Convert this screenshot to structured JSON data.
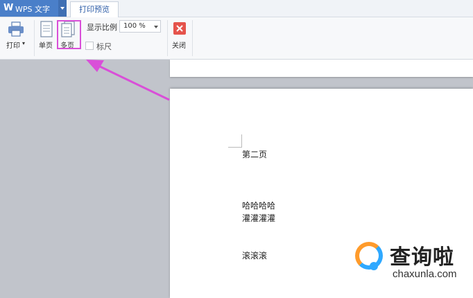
{
  "app": {
    "logo": "W",
    "title": "WPS 文字"
  },
  "tabs": [
    {
      "label": "打印预览",
      "active": true
    }
  ],
  "ribbon": {
    "print_label": "打印",
    "single_page_label": "单页",
    "multi_page_label": "多页",
    "zoom_label": "显示比例",
    "zoom_value": "100 %",
    "ruler_label": "标尺",
    "ruler_checked": false,
    "close_label": "关闭"
  },
  "document": {
    "page_heading": "第二页",
    "lines": [
      "哈哈哈哈",
      "灌灌灌灌",
      "滚滚滚"
    ]
  },
  "watermark": {
    "text": "查询啦",
    "url": "chaxunla.com"
  },
  "colors": {
    "accent": "#4a7fc9",
    "highlight": "#d94fd8",
    "close": "#e5534b",
    "preview_bg": "#c1c4cb"
  }
}
